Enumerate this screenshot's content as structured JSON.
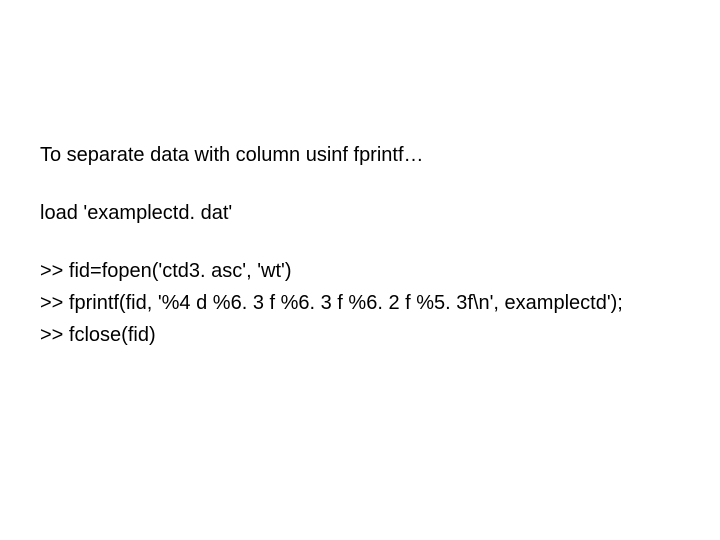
{
  "paragraphs": {
    "intro": "To separate data with column usinf fprintf…",
    "load": "load 'examplectd. dat'"
  },
  "code": {
    "line1": ">> fid=fopen('ctd3. asc', 'wt')",
    "line2": ">> fprintf(fid, '%4 d %6. 3 f %6. 3 f %6. 2 f %5. 3f\\n', examplectd');",
    "line3": ">> fclose(fid)"
  }
}
